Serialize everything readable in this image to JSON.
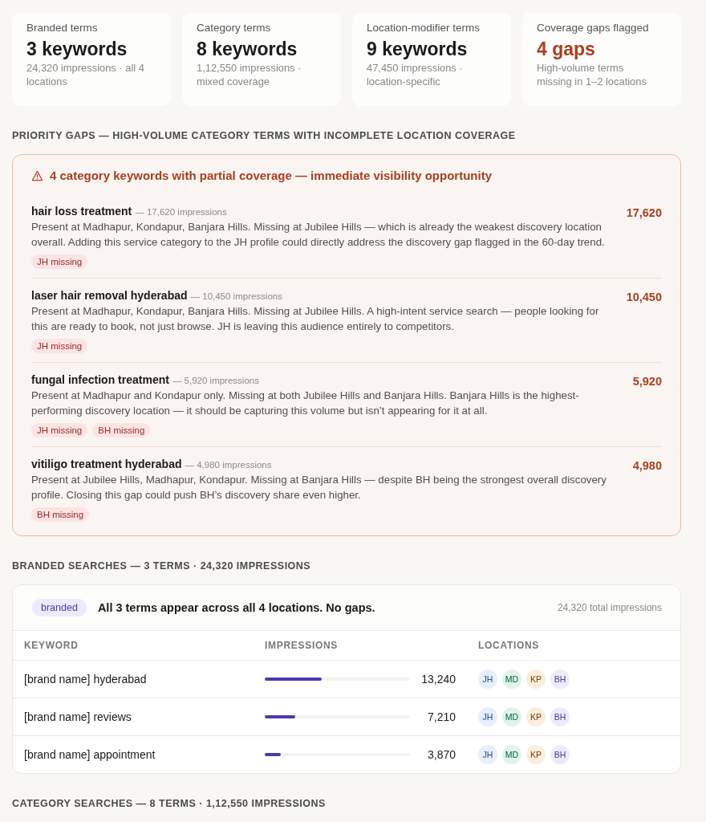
{
  "stats": [
    {
      "label": "Branded terms",
      "value": "3 keywords",
      "note": "24,320 impressions · all 4 locations",
      "highlighted": false
    },
    {
      "label": "Category terms",
      "value": "8 keywords",
      "note": "1,12,550 impressions · mixed coverage",
      "highlighted": false
    },
    {
      "label": "Location-modifier terms",
      "value": "9 keywords",
      "note": "47,450 impressions · location-specific",
      "highlighted": false
    },
    {
      "label": "Coverage gaps flagged",
      "value": "4 gaps",
      "note": "High-volume terms missing in 1–2 locations",
      "highlighted": true
    }
  ],
  "priority_gaps": {
    "heading": "PRIORITY GAPS — HIGH-VOLUME CATEGORY TERMS WITH INCOMPLETE LOCATION COVERAGE",
    "alert": "4 category keywords with partial coverage — immediate visibility opportunity",
    "items": [
      {
        "keyword": "hair loss treatment",
        "impressions_note": "— 17,620 impressions",
        "description": "Present at Madhapur, Kondapur, Banjara Hills. Missing at Jubilee Hills — which is already the weakest discovery location overall. Adding this service category to the JH profile could directly address the discovery gap flagged in the 60-day trend.",
        "tags": [
          "JH missing"
        ],
        "count": "17,620"
      },
      {
        "keyword": "laser hair removal hyderabad",
        "impressions_note": "— 10,450 impressions",
        "description": "Present at Madhapur, Kondapur, Banjara Hills. Missing at Jubilee Hills. A high-intent service search — people looking for this are ready to book, not just browse. JH is leaving this audience entirely to competitors.",
        "tags": [
          "JH missing"
        ],
        "count": "10,450"
      },
      {
        "keyword": "fungal infection treatment",
        "impressions_note": "— 5,920 impressions",
        "description": "Present at Madhapur and Kondapur only. Missing at both Jubilee Hills and Banjara Hills. Banjara Hills is the highest-performing discovery location — it should be capturing this volume but isn’t appearing for it at all.",
        "tags": [
          "JH missing",
          "BH missing"
        ],
        "count": "5,920"
      },
      {
        "keyword": "vitiligo treatment hyderabad",
        "impressions_note": "— 4,980 impressions",
        "description": "Present at Jubilee Hills, Madhapur, Kondapur. Missing at Banjara Hills — despite BH being the strongest overall discovery profile. Closing this gap could push BH’s discovery share even higher.",
        "tags": [
          "BH missing"
        ],
        "count": "4,980"
      }
    ]
  },
  "branded": {
    "heading": "BRANDED SEARCHES — 3 TERMS · 24,320 IMPRESSIONS",
    "badge": "branded",
    "summary": "All 3 terms appear across all 4 locations. No gaps.",
    "total": "24,320 total impressions",
    "columns": [
      "KEYWORD",
      "IMPRESSIONS",
      "LOCATIONS"
    ],
    "rows": [
      {
        "keyword": "[brand name] hyderabad",
        "level": 0.39,
        "impressions": "13,240",
        "locations": [
          {
            "label": "JH",
            "color": "#e6effd"
          },
          {
            "label": "MD",
            "color": "#e1f3ea"
          },
          {
            "label": "KP",
            "color": "#fbeedd"
          },
          {
            "label": "BH",
            "color": "#ecebfb"
          }
        ]
      },
      {
        "keyword": "[brand name] reviews",
        "level": 0.21,
        "impressions": "7,210",
        "locations": [
          {
            "label": "JH",
            "color": "#e6effd"
          },
          {
            "label": "MD",
            "color": "#e1f3ea"
          },
          {
            "label": "KP",
            "color": "#fbeedd"
          },
          {
            "label": "BH",
            "color": "#ecebfb"
          }
        ]
      },
      {
        "keyword": "[brand name] appointment",
        "level": 0.11,
        "impressions": "3,870",
        "locations": [
          {
            "label": "JH",
            "color": "#e6effd"
          },
          {
            "label": "MD",
            "color": "#e1f3ea"
          },
          {
            "label": "KP",
            "color": "#fbeedd"
          },
          {
            "label": "BH",
            "color": "#ecebfb"
          }
        ]
      }
    ]
  },
  "category": {
    "heading": "CATEGORY SEARCHES — 8 TERMS · 1,12,550 IMPRESSIONS"
  }
}
